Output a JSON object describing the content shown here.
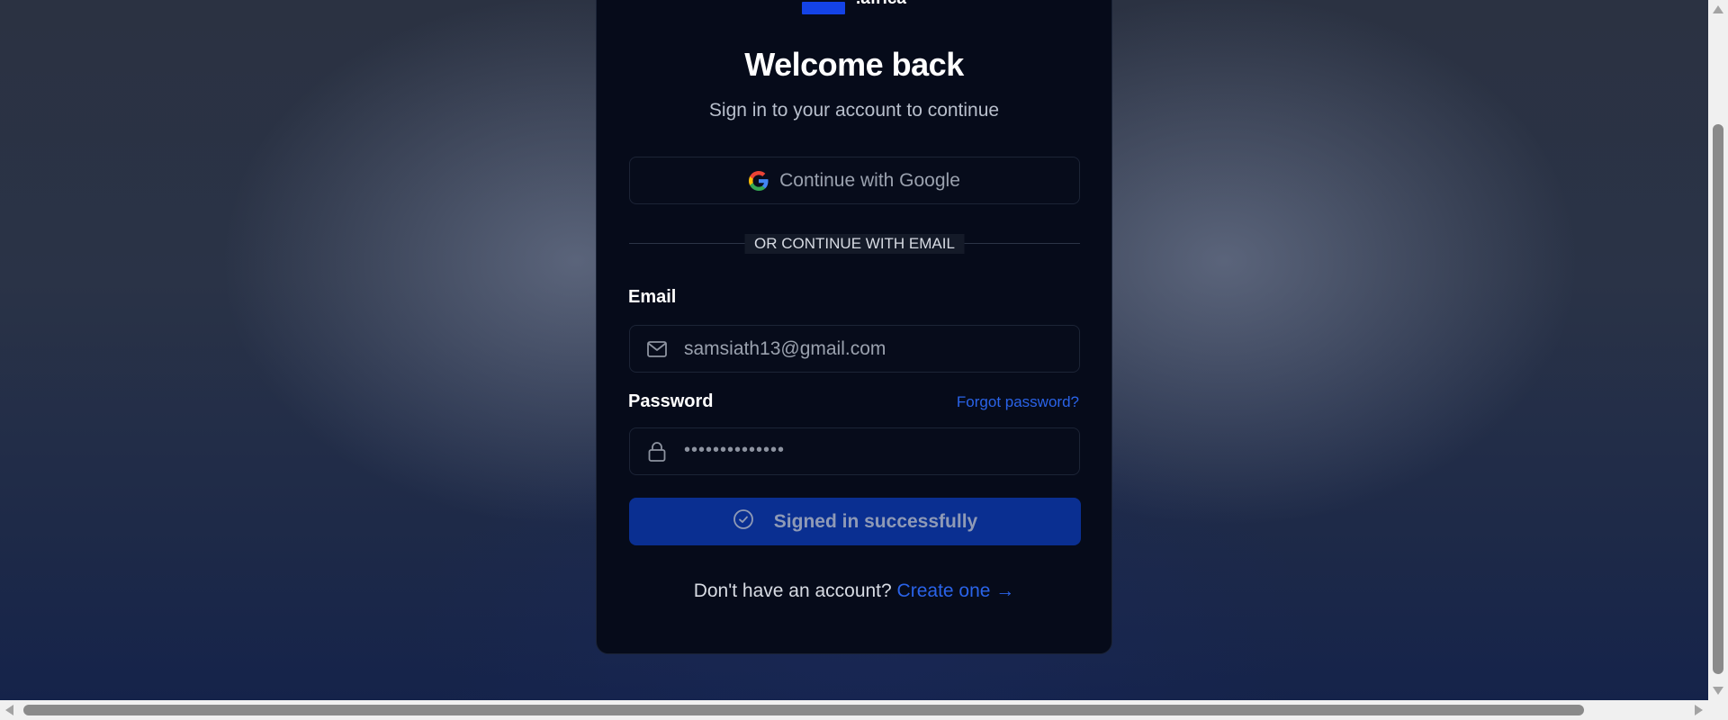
{
  "brand": {
    "logo_text": ".africa",
    "accent_color": "#1443e6"
  },
  "login": {
    "title": "Welcome back",
    "subtitle": "Sign in to your account to continue",
    "google_button_label": "Continue with Google",
    "divider_text": "OR CONTINUE WITH EMAIL",
    "email_label": "Email",
    "email_value": "samsiath13@gmail.com",
    "email_icon": "mail-icon",
    "password_label": "Password",
    "forgot_password_link": "Forgot password?",
    "password_masked": "••••••••••••••",
    "password_icon": "lock-icon",
    "submit_button_label": "Signed in successfully",
    "submit_icon": "check-circle-icon",
    "signup_prompt": "Don't have an account?",
    "signup_link": "Create one →"
  },
  "colors": {
    "card_background": "#060b1a",
    "submit_background": "#0a2f91",
    "link_color": "#2a63e8"
  }
}
